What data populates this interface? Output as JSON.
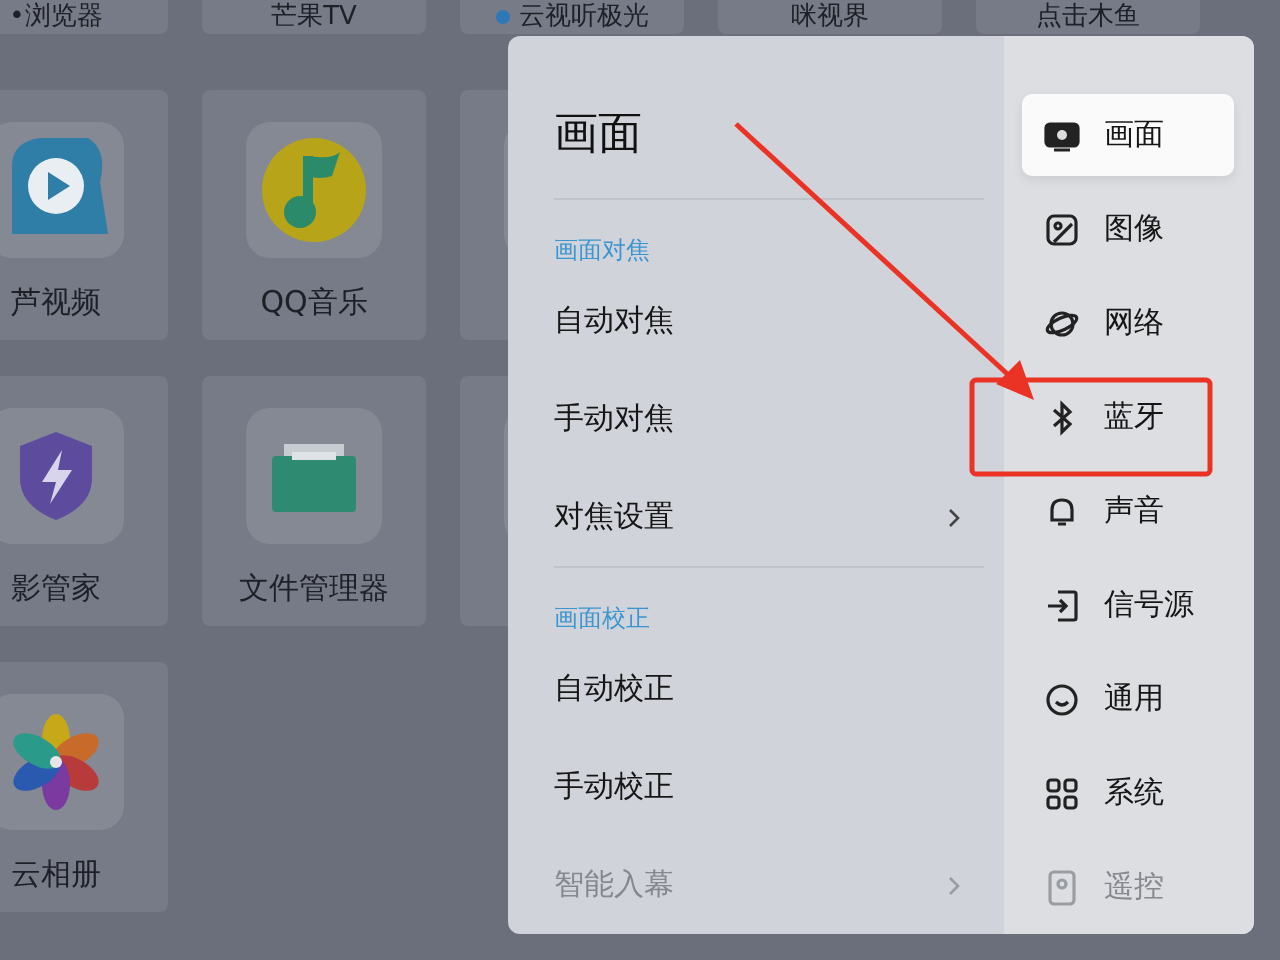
{
  "app_rows": [
    [
      {
        "label": "•浏览器",
        "kind": "text"
      },
      {
        "label": "芒果TV",
        "kind": "text"
      },
      {
        "label": "云视听极光",
        "kind": "text",
        "dot": true
      },
      {
        "label": "咪视界",
        "kind": "text"
      },
      {
        "label": "点击木鱼",
        "kind": "text"
      }
    ],
    [
      {
        "label": "芦视频",
        "kind": "video"
      },
      {
        "label": "QQ音乐",
        "kind": "music"
      },
      {
        "kind": "blue"
      }
    ],
    [
      {
        "label": "影管家",
        "kind": "shield"
      },
      {
        "label": "文件管理器",
        "kind": "folder"
      },
      {
        "kind": "blue"
      }
    ],
    [
      {
        "label": "云相册",
        "kind": "flower"
      }
    ]
  ],
  "settings": {
    "title": "画面",
    "sections": [
      {
        "heading": "画面对焦",
        "items": [
          {
            "label": "自动对焦",
            "submenu": false,
            "dimmed": false
          },
          {
            "label": "手动对焦",
            "submenu": false,
            "dimmed": false
          },
          {
            "label": "对焦设置",
            "submenu": true,
            "dimmed": false
          }
        ]
      },
      {
        "heading": "画面校正",
        "items": [
          {
            "label": "自动校正",
            "submenu": false,
            "dimmed": false
          },
          {
            "label": "手动校正",
            "submenu": false,
            "dimmed": false
          },
          {
            "label": "智能入幕",
            "submenu": true,
            "dimmed": true
          }
        ]
      }
    ],
    "nav": [
      {
        "label": "画面",
        "kind": "screen",
        "selected": true,
        "dimmed": false
      },
      {
        "label": "图像",
        "kind": "image",
        "selected": false,
        "dimmed": false
      },
      {
        "label": "网络",
        "kind": "planet",
        "selected": false,
        "dimmed": false
      },
      {
        "label": "蓝牙",
        "kind": "bluetooth",
        "selected": false,
        "dimmed": false
      },
      {
        "label": "声音",
        "kind": "bell",
        "selected": false,
        "dimmed": false
      },
      {
        "label": "信号源",
        "kind": "input",
        "selected": false,
        "dimmed": false
      },
      {
        "label": "通用",
        "kind": "smile",
        "selected": false,
        "dimmed": false
      },
      {
        "label": "系统",
        "kind": "grid",
        "selected": false,
        "dimmed": false
      },
      {
        "label": "遥控",
        "kind": "remote",
        "selected": false,
        "dimmed": true
      }
    ]
  }
}
